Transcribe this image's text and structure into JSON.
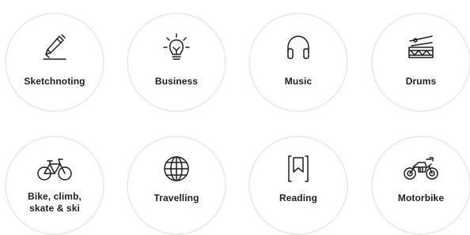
{
  "interests": [
    {
      "label": "Sketchnoting",
      "icon": "pencil-icon"
    },
    {
      "label": "Business",
      "icon": "lightbulb-icon"
    },
    {
      "label": "Music",
      "icon": "headphones-icon"
    },
    {
      "label": "Drums",
      "icon": "drum-icon"
    },
    {
      "label_lines": [
        "Bike, climb,",
        "skate & ski"
      ],
      "icon": "bicycle-icon"
    },
    {
      "label": "Travelling",
      "icon": "globe-icon"
    },
    {
      "label": "Reading",
      "icon": "bookmark-book-icon"
    },
    {
      "label": "Motorbike",
      "icon": "motorbike-icon"
    }
  ],
  "colors": {
    "tile_border": "#ececec",
    "icon_stroke": "#1e1e1e",
    "text": "#1e1e1e",
    "background": "#ffffff"
  }
}
